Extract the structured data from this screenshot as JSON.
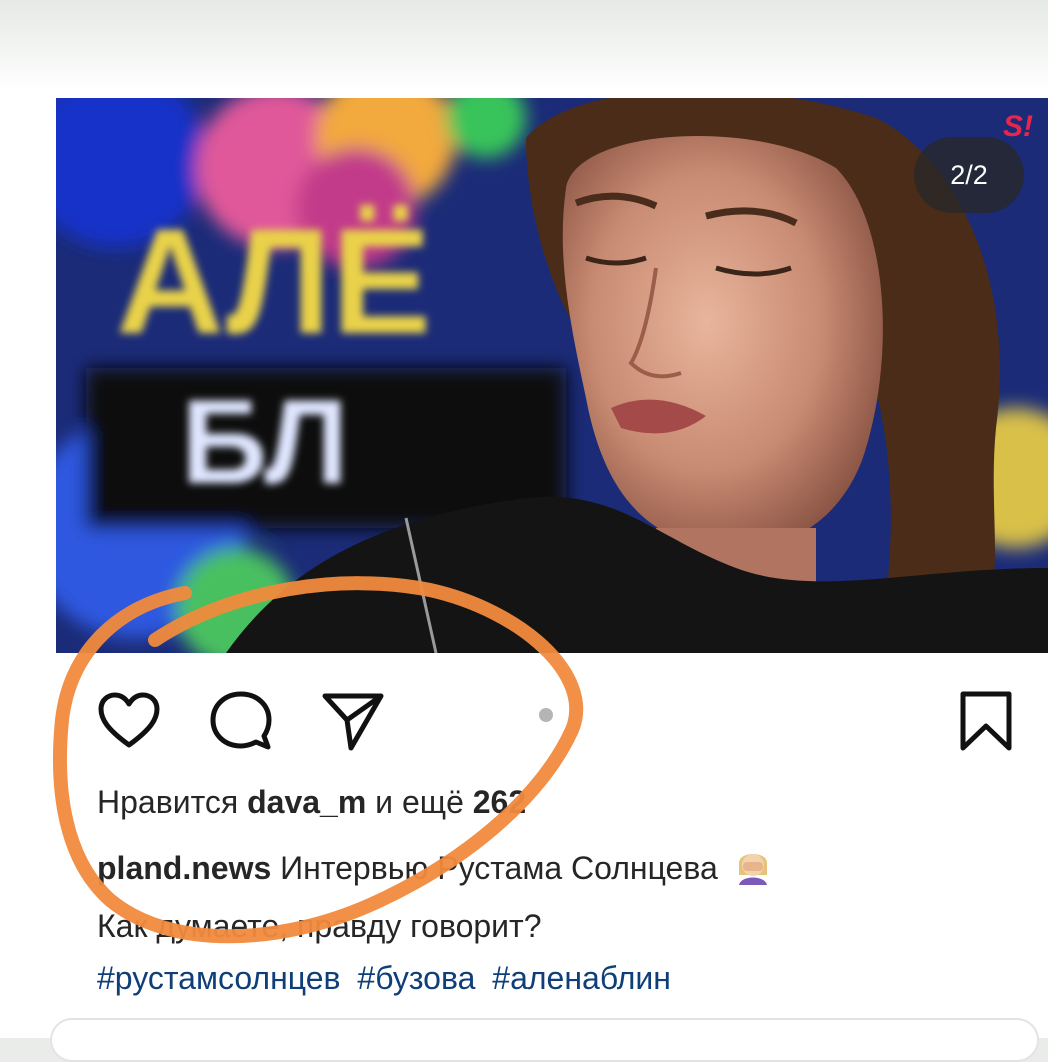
{
  "post": {
    "counter": "2/2",
    "brand_mark": "S!",
    "image_sign_top": "АЛЁ",
    "image_sign_bottom": "БЛ"
  },
  "actions": {
    "like_icon": "heart-icon",
    "comment_icon": "comment-icon",
    "share_icon": "send-icon",
    "save_icon": "bookmark-icon"
  },
  "likes": {
    "prefix": "Нравится",
    "user": "dava_m",
    "middle": "и ещё",
    "count": "262"
  },
  "caption": {
    "author": "pland.news",
    "text_line1": "Интервью Рустама Солнцева",
    "text_line2": "Как думаете, правду говорит?",
    "hashtags": [
      "#рустамсолнцев",
      "#бузова",
      "#аленаблин"
    ]
  },
  "colors": {
    "marker": "#f08a3c",
    "hashtag": "#0f3f78",
    "text": "#262626",
    "brand": "#e8264d"
  }
}
